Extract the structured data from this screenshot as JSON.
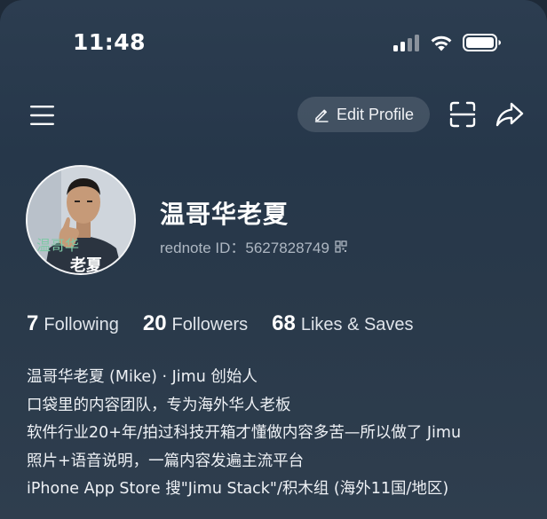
{
  "status_bar": {
    "time": "11:48",
    "signal_icon": "cellular-signal-icon",
    "wifi_icon": "wifi-icon",
    "battery_icon": "battery-icon"
  },
  "top_bar": {
    "menu_icon": "hamburger-menu-icon",
    "edit_profile_label": "Edit Profile",
    "scan_icon": "scan-icon",
    "share_icon": "share-icon"
  },
  "profile": {
    "avatar_caption_top": "温哥华",
    "avatar_caption_bottom": "老夏",
    "name": "温哥华老夏",
    "id_label": "rednote ID：5627828749"
  },
  "stats": [
    {
      "count": "7",
      "label": "Following"
    },
    {
      "count": "20",
      "label": "Followers"
    },
    {
      "count": "68",
      "label": "Likes & Saves"
    }
  ],
  "bio": [
    "温哥华老夏 (Mike) · Jimu 创始人",
    "口袋里的内容团队，专为海外华人老板",
    "软件行业20+年/拍过科技开箱才懂做内容多苦—所以做了 Jimu",
    "照片+语音说明，一篇内容发遍主流平台",
    "iPhone App Store 搜\"Jimu Stack\"/积木组 (海外11国/地区)"
  ],
  "colors": {
    "background_top": "#2c3d50",
    "background_bottom": "#2f3e4e",
    "text_primary": "#ffffff",
    "text_secondary": "#aeb7c2"
  }
}
